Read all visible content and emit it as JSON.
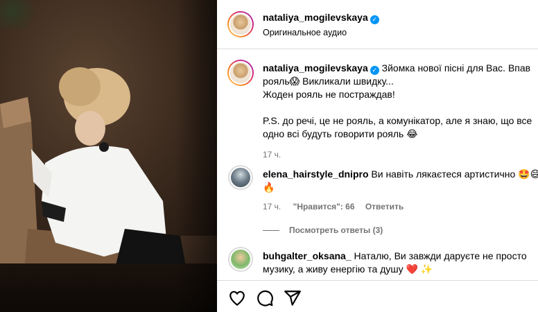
{
  "post_author": {
    "username": "nataliya_mogilevskaya",
    "audio_label": "Оригинальное аудио",
    "verified_icon": "verified-badge-icon",
    "verified_glyph": "✓"
  },
  "caption": {
    "username": "nataliya_mogilevskaya",
    "line1_rest": "Зйомка нової пісні для Вас. Впав",
    "line2": "рояль😱 Викликали швидку...",
    "line3": "Жоден рояль не постраждав!",
    "line4": "P.S. до речі, це не рояль, а комунікатор, але я знаю, що все",
    "line5": "одно всі будуть говорити рояль 😂",
    "time": "17 ч."
  },
  "comments": [
    {
      "username": "elena_hairstyle_dnipro",
      "text_line1": "Ви навіть лякаєтеся артистично 🤩😅",
      "text_line2": "🔥",
      "time": "17 ч.",
      "likes": "\"Нравится\": 66",
      "reply": "Ответить",
      "view_replies": "Посмотреть ответы (3)"
    },
    {
      "username": "buhgalter_oksana_",
      "text_line1": "Наталю, Ви завжди даруєте не просто",
      "text_line2": "музику, а живу енергію та душу ❤️ ✨"
    }
  ],
  "actions": {
    "like_icon": "heart-icon",
    "comment_icon": "comment-icon",
    "share_icon": "share-icon"
  },
  "colors": {
    "verified": "#0095f6",
    "secondary_text": "#737373",
    "divider": "#dbdbdb"
  }
}
